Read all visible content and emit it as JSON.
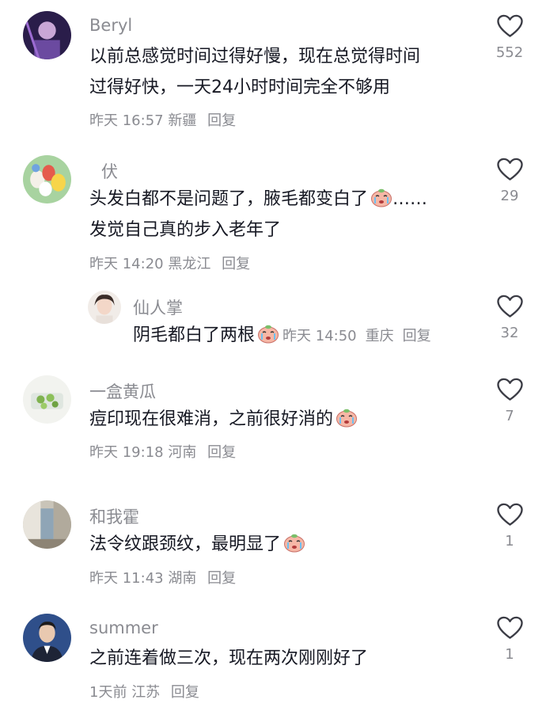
{
  "comments": [
    {
      "user": "Beryl",
      "lines": [
        "以前总感觉时间过得好慢，现在总觉得时间",
        "过得好快，一天24小时时间完全不够用"
      ],
      "time": "昨天 16:57",
      "location": "新疆",
      "reply": "回复",
      "likes": "552"
    },
    {
      "user": "伏",
      "lines": [
        "头发白都不是问题了，腋毛都变白了",
        "……",
        "发觉自己真的步入老年了"
      ],
      "time": "昨天 14:20",
      "location": "黑龙江",
      "reply": "回复",
      "likes": "29"
    },
    {
      "user": "仙人掌",
      "text": "阴毛都白了两根",
      "time": "昨天 14:50",
      "location": "重庆",
      "reply": "回复",
      "likes": "32"
    },
    {
      "user": "一盒黄瓜",
      "text": "痘印现在很难消，之前很好消的",
      "time": "昨天 19:18",
      "location": "河南",
      "reply": "回复",
      "likes": "7"
    },
    {
      "user": "和我霍",
      "text": "法令纹跟颈纹，最明显了",
      "time": "昨天 11:43",
      "location": "湖南",
      "reply": "回复",
      "likes": "1"
    },
    {
      "user": "summer",
      "text": "之前连着做三次，现在两次刚刚好了",
      "time": "1天前",
      "location": "江苏",
      "reply": "回复",
      "likes": "1"
    }
  ],
  "icons": {
    "like": "heart-outline-icon",
    "emoji": "crying-face-emoji"
  },
  "colors": {
    "secondary_text": "#8a8b91",
    "primary_text": "#161823"
  }
}
